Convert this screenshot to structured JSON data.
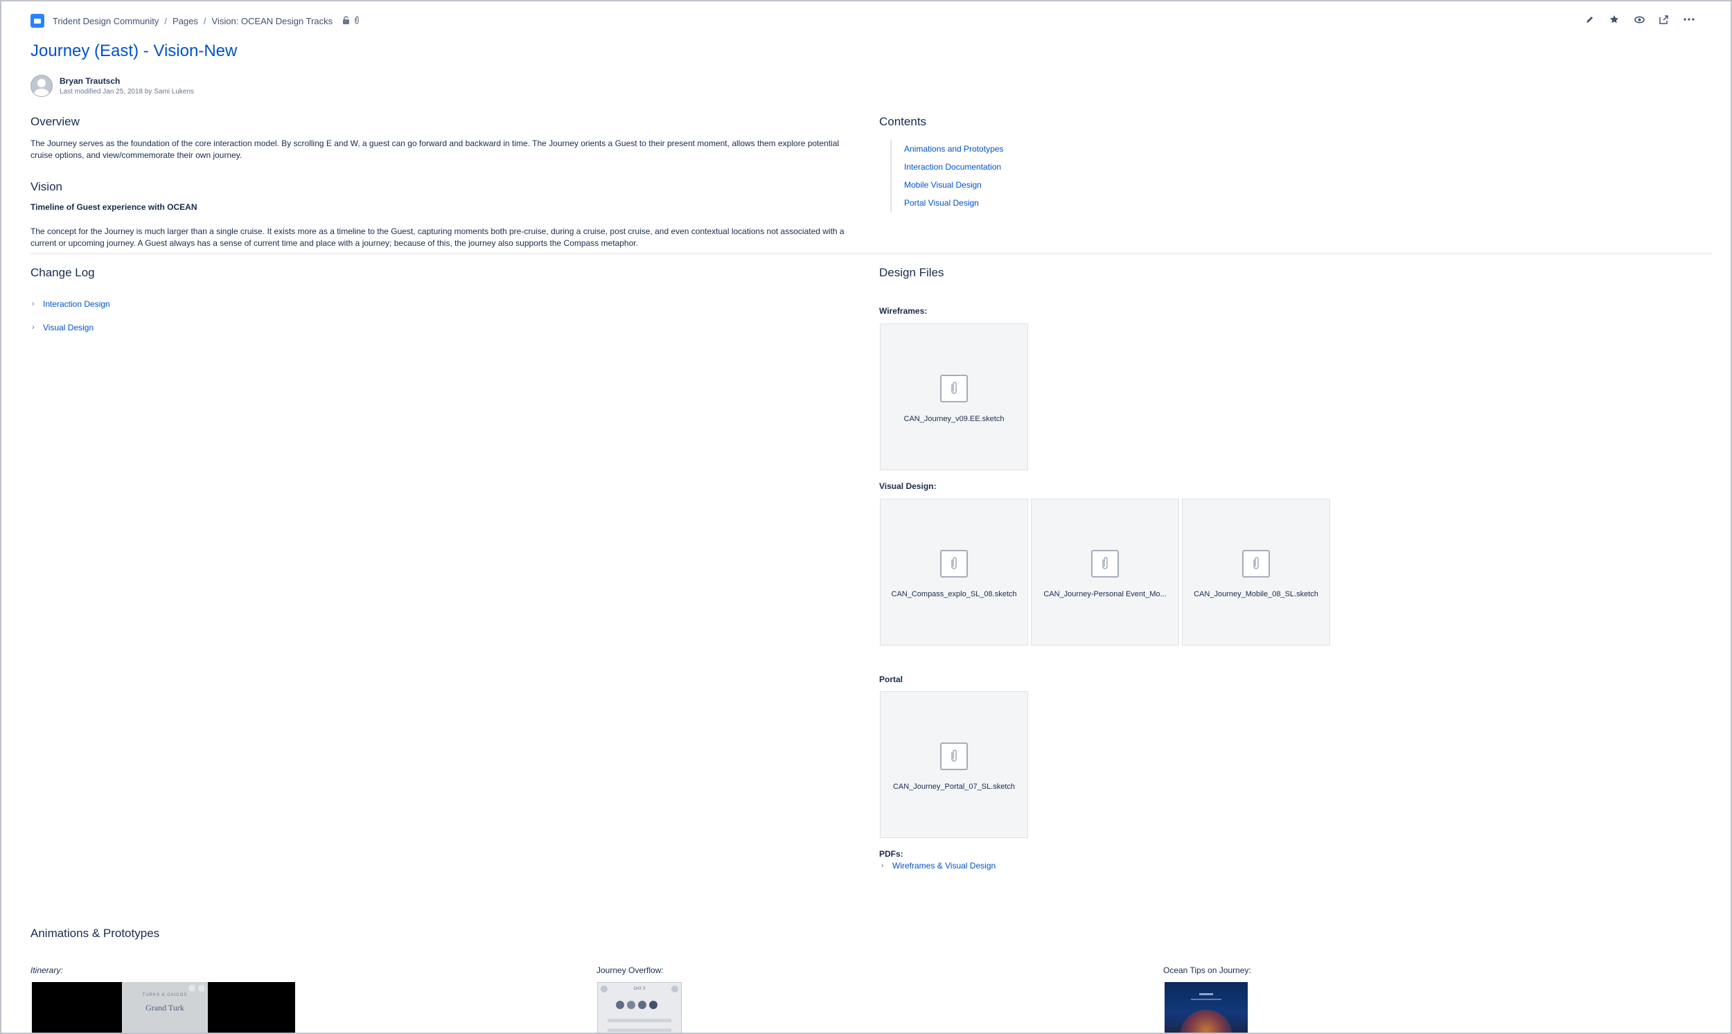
{
  "breadcrumb": {
    "space": "Trident Design Community",
    "items": [
      "Pages",
      "Vision: OCEAN Design Tracks"
    ]
  },
  "page": {
    "title": "Journey (East) - Vision-New",
    "author": "Bryan Trautsch",
    "modified": "Last modified Jan 25, 2018 by Sami Lukens"
  },
  "overview": {
    "heading": "Overview",
    "text": "The Journey serves as the foundation of the core interaction model. By scrolling E and W, a guest can go forward and backward in time. The Journey orients a Guest to their present moment, allows them explore potential cruise options, and view/commemorate their own journey."
  },
  "vision": {
    "heading": "Vision",
    "subheading": "Timeline of Guest experience with OCEAN",
    "text": "The concept for the Journey is much larger than a single cruise. It exists more as a timeline to the Guest, capturing moments both pre-cruise, during a cruise, post cruise, and even contextual locations not associated with a current or upcoming journey. A Guest always has a sense of current time and place with a journey; because of this, the journey also supports the Compass metaphor."
  },
  "contents": {
    "heading": "Contents",
    "items": [
      "Animations and Prototypes",
      "Interaction Documentation",
      "Mobile Visual Design",
      "Portal Visual Design"
    ]
  },
  "changelog": {
    "heading": "Change Log",
    "items": [
      "Interaction Design",
      "Visual Design"
    ]
  },
  "design_files": {
    "heading": "Design Files",
    "wireframes_label": "Wireframes:",
    "wireframes": [
      "CAN_Journey_v09.EE.sketch"
    ],
    "visual_label": "Visual Design:",
    "visual": [
      "CAN_Compass_explo_SL_08.sketch",
      "CAN_Journey-Personal Event_Mo...",
      "CAN_Journey_Mobile_08_SL.sketch"
    ],
    "portal_label": "Portal",
    "portal": [
      "CAN_Journey_Portal_07_SL.sketch"
    ],
    "pdfs_label": "PDFs:",
    "pdf_link": "Wireframes & Visual Design"
  },
  "animations": {
    "heading": "Animations & Prototypes",
    "itinerary_label": "Itinerary:",
    "itinerary_thumb_title": "Grand Turk",
    "itinerary_thumb_caption": "TURKS & CAICOS",
    "overflow_label": "Journey Overflow:",
    "overflow_thumb_caption": "DAY 3",
    "tips_label": "Ocean Tips on Journey:"
  },
  "colors": {
    "link": "#0052cc",
    "text": "#172b4d",
    "space_logo": "#2684ff",
    "tile_bg": "#f4f5f7"
  },
  "icons": [
    "edit-icon",
    "star-icon",
    "watch-icon",
    "share-icon",
    "more-icon",
    "restriction-icon",
    "attachment-icon",
    "paperclip-icon"
  ]
}
